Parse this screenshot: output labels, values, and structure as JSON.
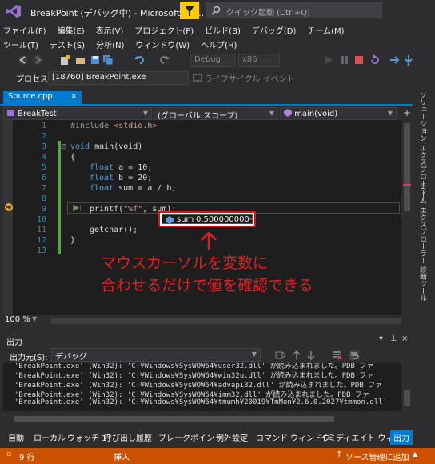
{
  "title_bar": {
    "title": "BreakPoint (デバッグ中) - Microsoft Vis...",
    "quick_launch_placeholder": "クイック起動 (Ctrl+Q)"
  },
  "menu_row1": [
    "ファイル(F)",
    "編集(E)",
    "表示(V)",
    "プロジェクト(P)",
    "ビルド(B)",
    "デバッグ(D)",
    "チーム(M)"
  ],
  "menu_row2": [
    "ツール(T)",
    "テスト(S)",
    "分析(N)",
    "ウィンドウ(W)",
    "ヘルプ(H)"
  ],
  "toolbar": {
    "config": "Debug",
    "platform": "x86"
  },
  "process_bar": {
    "label": "プロセス:",
    "process": "[18760] BreakPoint.exe",
    "lifecycle": "ライフサイクル イベント"
  },
  "right_dock": [
    "ソリューション エクスプローラー",
    "チーム エクスプローラー",
    "診断ツール"
  ],
  "doc_tab": {
    "label": "Source.cpp",
    "close": "×"
  },
  "nav": {
    "project": "BreakTest",
    "scope": "(グローバル スコープ)",
    "member": "main(void)"
  },
  "code_lines": {
    "numbers": [
      "1",
      "2",
      "3",
      "4",
      "5",
      "6",
      "7",
      "8",
      "9",
      "10",
      "11",
      "12",
      "13"
    ],
    "l1_pp": "#include ",
    "l1_str": "<stdio.h>",
    "l3_kw": "void",
    "l3_rest": " main(void)",
    "l4": "{",
    "l5_kw": "float",
    "l5_rest": " a = 10;",
    "l6_kw": "float",
    "l6_rest": " b = 20;",
    "l7_kw": "float",
    "l7_rest": " sum = a / b;",
    "l9_a": "printf(",
    "l9_str": "\"%f\"",
    "l9_b": ", sum);",
    "l11": "getchar();",
    "l12": "}"
  },
  "datatip": {
    "name": "sum",
    "value": "0.500000000"
  },
  "annotation": {
    "line1": "マウスカーソルを変数に",
    "line2": "合わせるだけで値を確認できる"
  },
  "zoom": "100 %",
  "output": {
    "title": "出力",
    "source_label": "出力元(S):",
    "source_value": "デバッグ",
    "lines": [
      "'BreakPoint.exe' (Win32): 'C:¥Windows¥SysWOW64¥user32.dll' が読み込まれました。PDB ファ",
      "'BreakPoint.exe' (Win32): 'C:¥Windows¥SysWOW64¥win32u.dll' が読み込まれました。PDB ファ",
      "'BreakPoint.exe' (Win32): 'C:¥Windows¥SysWOW64¥advapi32.dll' が読み込まれました。PDB ファ",
      "'BreakPoint.exe' (Win32): 'C:¥Windows¥SysWOW64¥imm32.dll' が読み込まれました。PDB ファ",
      "'BreakPoint.exe' (Win32): 'C:¥Windows¥SysWOW64¥tmumh¥20019¥TmMon¥2.6.0.2027¥tmmon.dll' "
    ]
  },
  "bottom_tabs": [
    "自動",
    "ローカル",
    "ウォッチ 1",
    "呼び出し履歴",
    "ブレークポイント",
    "例外設定",
    "コマンド ウィンドウ",
    "イミディエイト ウィ...",
    "出力"
  ],
  "status": {
    "line": "9 行",
    "mode": "挿入",
    "source_control": "ソース管理に追加"
  },
  "colors": {
    "accent": "#007acc",
    "status_debug": "#ca5100",
    "annotation": "#e02020"
  }
}
